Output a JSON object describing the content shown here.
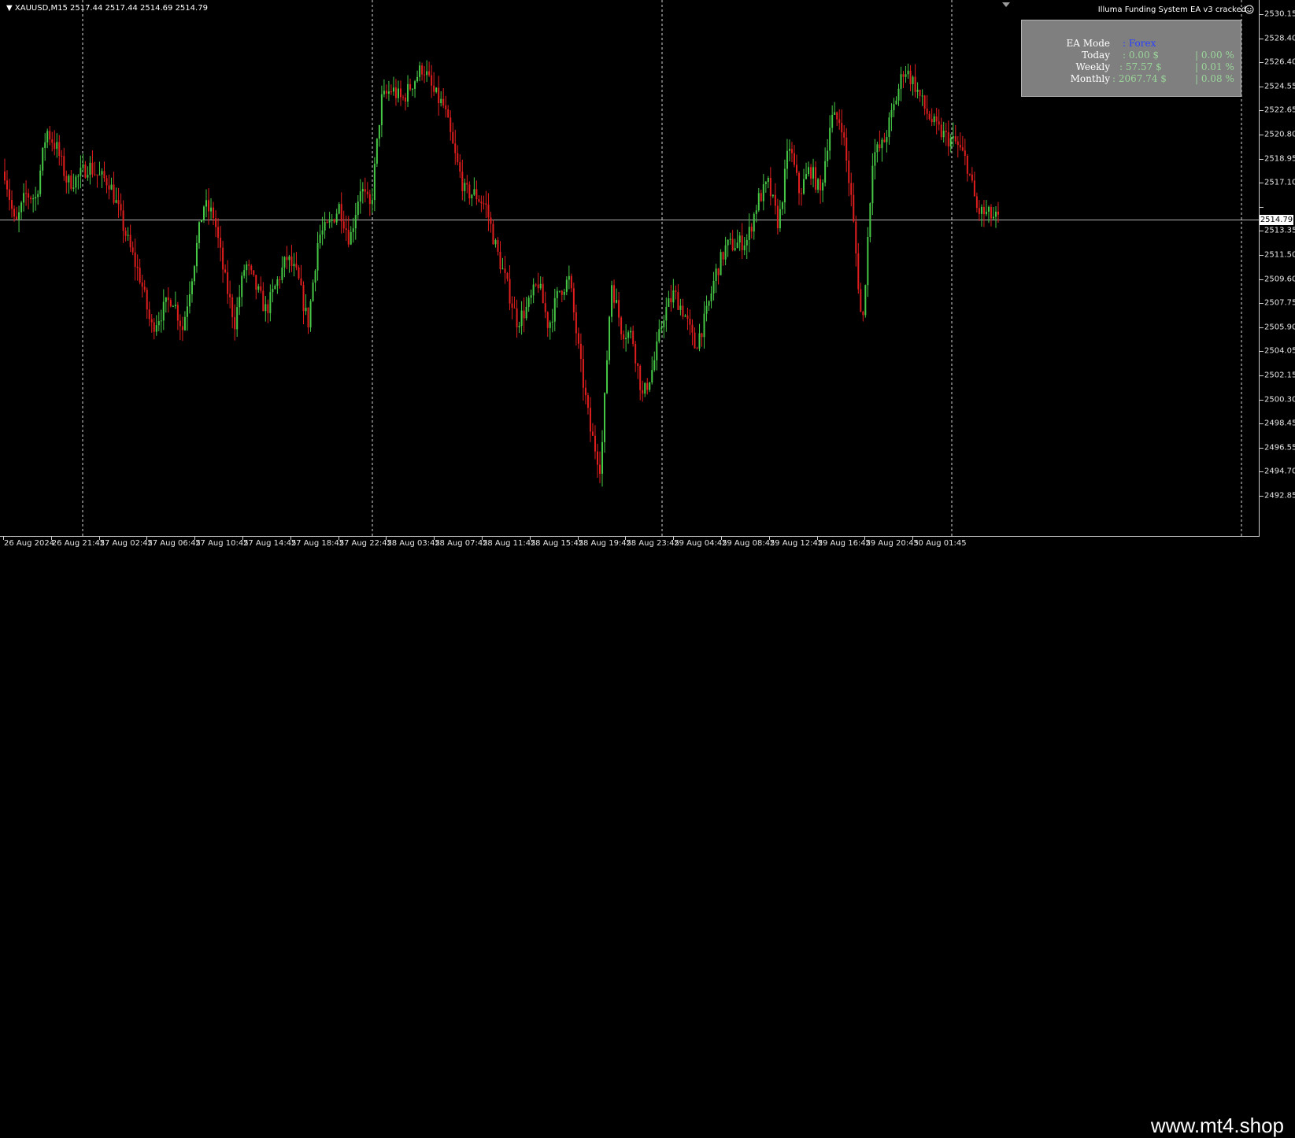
{
  "symbol": {
    "header": "XAUUSD,M15  2517.44 2517.44 2514.69 2514.79",
    "pair": "XAUUSD",
    "timeframe": "M15",
    "open": 2517.44,
    "high": 2517.44,
    "low": 2514.69,
    "close": 2514.79
  },
  "ea_title": "Illuma Funding System EA  v3 cracked",
  "ea_panel": {
    "mode_label": "EA Mode",
    "mode_value": ": Forex",
    "rows": [
      {
        "label": "Today",
        "value": ": 0.00 $",
        "pct": "| 0.00 %"
      },
      {
        "label": "Weekly",
        "value": ": 57.57 $",
        "pct": "| 0.01 %"
      },
      {
        "label": "Monthly",
        "value": ": 2067.74 $",
        "pct": "| 0.08 %"
      }
    ]
  },
  "current_price": "2514.79",
  "current_price_partial": "2515.20",
  "price_ticks": [
    "2530.15",
    "2528.40",
    "2526.40",
    "2524.55",
    "2522.65",
    "2520.80",
    "2518.95",
    "2517.10",
    "2515.20",
    "2513.35",
    "2511.50",
    "2509.60",
    "2507.75",
    "2505.90",
    "2504.05",
    "2502.15",
    "2500.30",
    "2498.45",
    "2496.55",
    "2494.70",
    "2492.85"
  ],
  "time_ticks": [
    "26 Aug 2024",
    "26 Aug 21:45",
    "27 Aug 02:45",
    "27 Aug 06:45",
    "27 Aug 10:45",
    "27 Aug 14:45",
    "27 Aug 18:45",
    "27 Aug 22:45",
    "28 Aug 03:45",
    "28 Aug 07:45",
    "28 Aug 11:45",
    "28 Aug 15:45",
    "28 Aug 19:45",
    "28 Aug 23:45",
    "29 Aug 04:45",
    "29 Aug 08:45",
    "29 Aug 12:45",
    "29 Aug 16:45",
    "29 Aug 20:45",
    "30 Aug 01:45"
  ],
  "colors": {
    "bull": "#46c846",
    "bear": "#e01e1e",
    "background": "#000000",
    "grid_separator": "#ffffff",
    "price_line": "#b4b4b4"
  },
  "chart_data": {
    "type": "candlestick",
    "ylim": [
      2492.0,
      2531.0
    ],
    "close_path": [
      2518.6,
      2514.2,
      2516.8,
      2516.5,
      2521.9,
      2520.4,
      2517.7,
      2518.1,
      2519.1,
      2518.2,
      2517.8,
      2515.2,
      2512.5,
      2510.1,
      2506.3,
      2507.5,
      2508.8,
      2506.2,
      2510.9,
      2516.0,
      2515.1,
      2510.3,
      2506.7,
      2511.4,
      2509.5,
      2507.6,
      2509.8,
      2511.8,
      2510.3,
      2506.6,
      2513.5,
      2514.3,
      2515.9,
      2513.2,
      2517.4,
      2515.6,
      2524.2,
      2525.1,
      2524.2,
      2525.6,
      2526.9,
      2524.8,
      2523.7,
      2520.0,
      2517.0,
      2516.8,
      2515.9,
      2512.5,
      2509.7,
      2506.8,
      2507.9,
      2509.9,
      2506.4,
      2509.2,
      2510.1,
      2503.7,
      2498.2,
      2495.2,
      2510.0,
      2506.1,
      2505.7,
      2500.8,
      2503.2,
      2507.3,
      2509.0,
      2507.4,
      2504.8,
      2507.0,
      2510.6,
      2512.7,
      2512.9,
      2513.2,
      2516.3,
      2517.6,
      2514.4,
      2520.8,
      2516.9,
      2518.9,
      2516.9,
      2522.8,
      2522.6,
      2516.1,
      2506.0,
      2519.9,
      2520.7,
      2523.6,
      2526.8,
      2525.5,
      2523.5,
      2522.1,
      2521.3,
      2520.8,
      2519.3,
      2515.5,
      2515.2,
      2514.8
    ]
  }
}
